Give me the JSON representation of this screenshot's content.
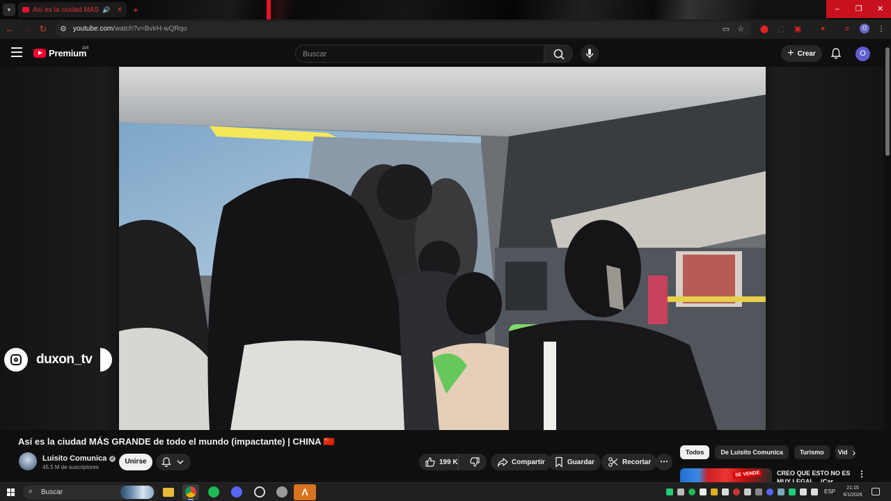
{
  "browser": {
    "tab_title": "Así es la ciudad MÁS GRANDE",
    "url_domain": "youtube.com",
    "url_path": "/watch?v=BvirH-wQRqo",
    "window_buttons": [
      "–",
      "❐",
      "✕"
    ]
  },
  "header": {
    "brand": "Premium",
    "region": "AR",
    "search_placeholder": "Buscar",
    "create_label": "Crear",
    "avatar_initial": "O"
  },
  "video": {
    "watermark_handle": "duxon_tv",
    "title": "Así es la ciudad MÁS GRANDE de todo el mundo (impactante) | CHINA 🇨🇳"
  },
  "channel": {
    "name": "Luisito Comunica",
    "subscribers": "45.5 M de suscriptores",
    "join_label": "Unirse"
  },
  "actions": {
    "likes": "199 K",
    "share_label": "Compartir",
    "save_label": "Guardar",
    "clip_label": "Recortar"
  },
  "chips": [
    "Todos",
    "De Luisito Comunica",
    "Turismo",
    "Vid"
  ],
  "recommendation": {
    "title": "CREO QUE ESTO NO ES MUY LEGAL... (Car Dealer",
    "thumb_label": "SE VENDE"
  },
  "taskbar": {
    "search_label": "Buscar",
    "language": "ESP",
    "time": "21:15",
    "date": "6/1/2026"
  },
  "colors": {
    "youtube_red": "#ff0033",
    "browser_accent": "#c8111f",
    "background": "#0f0f0f"
  }
}
